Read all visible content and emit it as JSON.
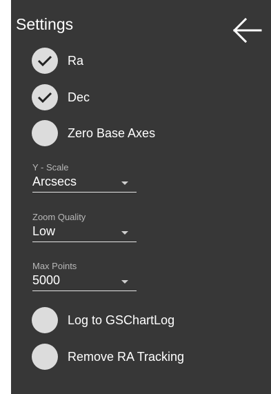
{
  "header": {
    "title": "Settings",
    "back_icon": "arrow-left-icon"
  },
  "colors": {
    "panel_bg": "#373737",
    "toggle_fill": "#dcdcdc",
    "checkmark": "#222222",
    "text": "#ffffff",
    "caption": "#b8b8b8"
  },
  "toggles": [
    {
      "label": "Ra",
      "checked": true
    },
    {
      "label": "Dec",
      "checked": true
    },
    {
      "label": "Zero Base Axes",
      "checked": false
    }
  ],
  "selects": [
    {
      "caption": "Y - Scale",
      "value": "Arcsecs"
    },
    {
      "caption": "Zoom Quality",
      "value": "Low"
    },
    {
      "caption": "Max Points",
      "value": "5000"
    }
  ],
  "bottom_toggles": [
    {
      "label": "Log to GSChartLog",
      "checked": false
    },
    {
      "label": "Remove RA Tracking",
      "checked": false
    }
  ]
}
